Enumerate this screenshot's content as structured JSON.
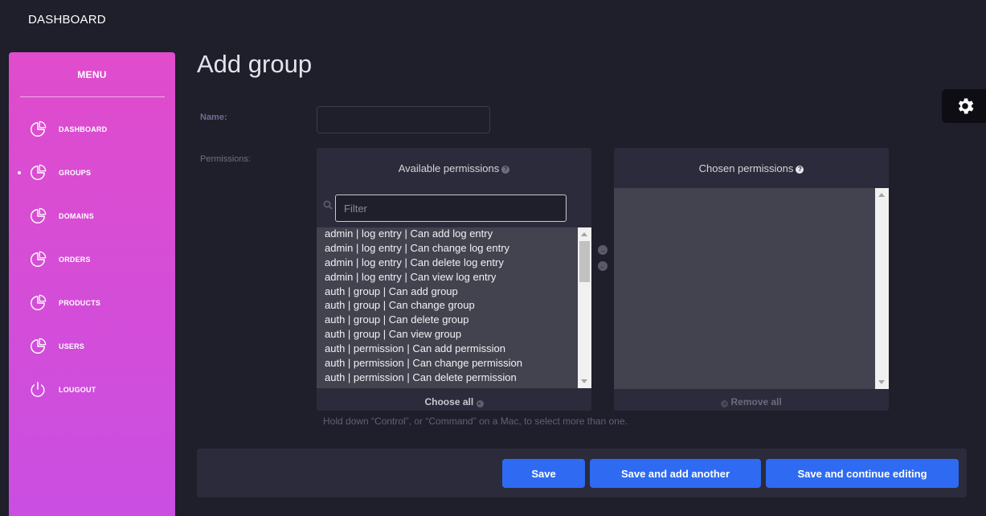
{
  "topbar": {
    "brand": "DASHBOARD"
  },
  "sidebar": {
    "title": "MENU",
    "items": [
      {
        "label": "DASHBOARD",
        "icon": "pie-chart-icon",
        "active": false
      },
      {
        "label": "GROUPS",
        "icon": "pie-chart-icon",
        "active": true
      },
      {
        "label": "DOMAINS",
        "icon": "pie-chart-icon",
        "active": false
      },
      {
        "label": "ORDERS",
        "icon": "pie-chart-icon",
        "active": false
      },
      {
        "label": "PRODUCTS",
        "icon": "pie-chart-icon",
        "active": false
      },
      {
        "label": "USERS",
        "icon": "pie-chart-icon",
        "active": false
      },
      {
        "label": "LOUGOUT",
        "icon": "power-icon",
        "active": false
      }
    ]
  },
  "page": {
    "title": "Add group"
  },
  "form": {
    "name_label": "Name:",
    "name_value": "",
    "permissions_label": "Permissions:",
    "available": {
      "title": "Available permissions",
      "help_glyph": "?",
      "filter_placeholder": "Filter",
      "items": [
        "admin | log entry | Can add log entry",
        "admin | log entry | Can change log entry",
        "admin | log entry | Can delete log entry",
        "admin | log entry | Can view log entry",
        "auth | group | Can add group",
        "auth | group | Can change group",
        "auth | group | Can delete group",
        "auth | group | Can view group",
        "auth | permission | Can add permission",
        "auth | permission | Can change permission",
        "auth | permission | Can delete permission"
      ],
      "choose_all": "Choose all"
    },
    "chosen": {
      "title": "Chosen permissions",
      "help_glyph": "?",
      "remove_all": "Remove all"
    },
    "help_text": "Hold down “Control”, or “Command” on a Mac, to select more than one."
  },
  "buttons": {
    "save": "Save",
    "save_add_another": "Save and add another",
    "save_continue": "Save and continue editing"
  },
  "colors": {
    "sidebar_top": "#e04ccc",
    "sidebar_bottom": "#c94ee2",
    "primary_button": "#2e6bf2",
    "background": "#1f1e2b",
    "panel": "#2b2b3b"
  }
}
